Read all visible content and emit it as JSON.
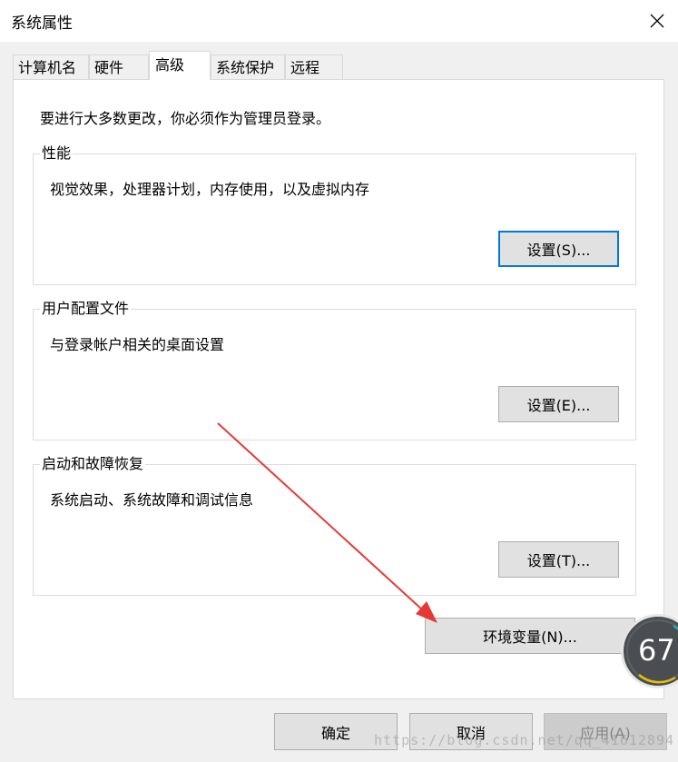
{
  "window": {
    "title": "系统属性"
  },
  "tabs": [
    {
      "label": "计算机名"
    },
    {
      "label": "硬件"
    },
    {
      "label": "高级"
    },
    {
      "label": "系统保护"
    },
    {
      "label": "远程"
    }
  ],
  "active_tab": "高级",
  "notice": "要进行大多数更改，你必须作为管理员登录。",
  "groups": {
    "performance": {
      "title": "性能",
      "description": "视觉效果，处理器计划，内存使用，以及虚拟内存",
      "button_label": "设置(S)..."
    },
    "user_profiles": {
      "title": "用户配置文件",
      "description": "与登录帐户相关的桌面设置",
      "button_label": "设置(E)..."
    },
    "startup_recovery": {
      "title": "启动和故障恢复",
      "description": "系统启动、系统故障和调试信息",
      "button_label": "设置(T)..."
    }
  },
  "env_button_label": "环境变量(N)...",
  "footer": {
    "ok_label": "确定",
    "cancel_label": "取消",
    "apply_label": "应用(A)"
  },
  "overlay_widget_value": "67",
  "watermark_text": "https://blog.csdn.net/qq_41612894",
  "colors": {
    "annotation_arrow": "#e53935",
    "focus_border": "#0078d7",
    "window_bg": "#f0f0f0"
  }
}
